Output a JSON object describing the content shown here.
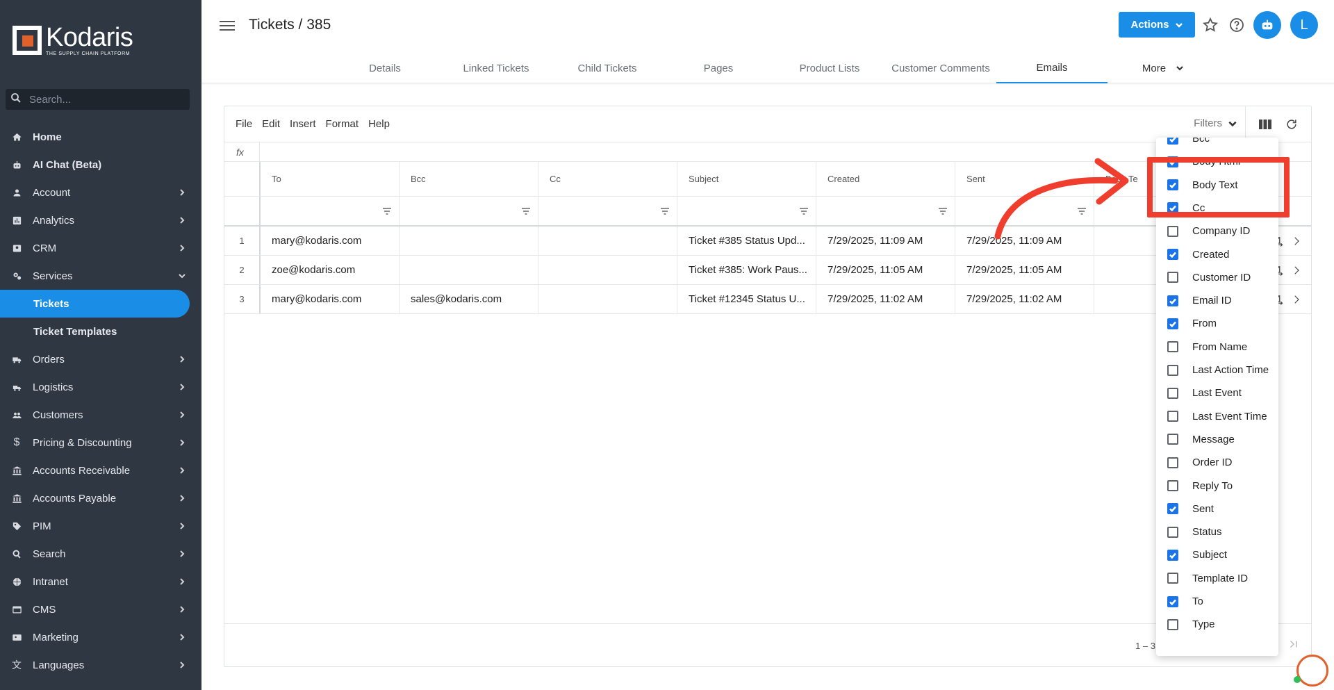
{
  "app": {
    "brand": "Kodaris",
    "tagline": "THE SUPPLY CHAIN PLATFORM"
  },
  "sidebar": {
    "search_placeholder": "Search...",
    "items": [
      {
        "label": "Home",
        "icon": "home-icon"
      },
      {
        "label": "AI Chat (Beta)",
        "icon": "robot-icon"
      },
      {
        "label": "Account",
        "icon": "person-icon"
      },
      {
        "label": "Analytics",
        "icon": "chart-icon"
      },
      {
        "label": "CRM",
        "icon": "contact-card-icon"
      },
      {
        "label": "Services",
        "icon": "gears-icon"
      },
      {
        "label": "Tickets",
        "icon": ""
      },
      {
        "label": "Ticket Templates",
        "icon": ""
      },
      {
        "label": "Orders",
        "icon": "truck-icon"
      },
      {
        "label": "Logistics",
        "icon": "shipping-icon"
      },
      {
        "label": "Customers",
        "icon": "people-icon"
      },
      {
        "label": "Pricing & Discounting",
        "icon": "dollar-icon"
      },
      {
        "label": "Accounts Receivable",
        "icon": "bank-icon"
      },
      {
        "label": "Accounts Payable",
        "icon": "bank-icon"
      },
      {
        "label": "PIM",
        "icon": "tag-icon"
      },
      {
        "label": "Search",
        "icon": "search-icon"
      },
      {
        "label": "Intranet",
        "icon": "globe-icon"
      },
      {
        "label": "CMS",
        "icon": "web-icon"
      },
      {
        "label": "Marketing",
        "icon": "marketing-icon"
      },
      {
        "label": "Languages",
        "icon": "translate-icon"
      }
    ]
  },
  "header": {
    "title": "Tickets / 385",
    "actions_label": "Actions",
    "avatar_initial": "L",
    "tabs": [
      "Details",
      "Linked Tickets",
      "Child Tickets",
      "Pages",
      "Product Lists",
      "Customer Comments",
      "Emails",
      "More"
    ],
    "active_tab": "Emails"
  },
  "grid": {
    "menu": [
      "File",
      "Edit",
      "Insert",
      "Format",
      "Help"
    ],
    "filters_label": "Filters",
    "fx_label": "fx",
    "columns": [
      "To",
      "Bcc",
      "Cc",
      "Subject",
      "Created",
      "Sent",
      "Body Te"
    ],
    "rows": [
      {
        "num": "1",
        "to": "mary@kodaris.com",
        "bcc": "",
        "cc": "",
        "subject": "Ticket #385 Status Upd...",
        "created": "7/29/2025, 11:09 AM",
        "sent": "7/29/2025, 11:09 AM"
      },
      {
        "num": "2",
        "to": "zoe@kodaris.com",
        "bcc": "",
        "cc": "",
        "subject": "Ticket #385: Work Paus...",
        "created": "7/29/2025, 11:05 AM",
        "sent": "7/29/2025, 11:05 AM"
      },
      {
        "num": "3",
        "to": "mary@kodaris.com",
        "bcc": "sales@kodaris.com",
        "cc": "",
        "subject": "Ticket #12345 Status U...",
        "created": "7/29/2025, 11:02 AM",
        "sent": "7/29/2025, 11:02 AM"
      }
    ],
    "pager_text": "1 – 3"
  },
  "column_chooser": [
    {
      "label": "Bcc",
      "checked": true
    },
    {
      "label": "Body Html",
      "checked": true
    },
    {
      "label": "Body Text",
      "checked": true
    },
    {
      "label": "Cc",
      "checked": true
    },
    {
      "label": "Company ID",
      "checked": false
    },
    {
      "label": "Created",
      "checked": true
    },
    {
      "label": "Customer ID",
      "checked": false
    },
    {
      "label": "Email ID",
      "checked": true
    },
    {
      "label": "From",
      "checked": true
    },
    {
      "label": "From Name",
      "checked": false
    },
    {
      "label": "Last Action Time",
      "checked": false
    },
    {
      "label": "Last Event",
      "checked": false
    },
    {
      "label": "Last Event Time",
      "checked": false
    },
    {
      "label": "Message",
      "checked": false
    },
    {
      "label": "Order ID",
      "checked": false
    },
    {
      "label": "Reply To",
      "checked": false
    },
    {
      "label": "Sent",
      "checked": true
    },
    {
      "label": "Status",
      "checked": false
    },
    {
      "label": "Subject",
      "checked": true
    },
    {
      "label": "Template ID",
      "checked": false
    },
    {
      "label": "To",
      "checked": true
    },
    {
      "label": "Type",
      "checked": false
    }
  ],
  "colors": {
    "sidebar_bg": "#2f3742",
    "accent": "#1a8ee6",
    "annotation": "#f03e2e",
    "brand_orange": "#e2612b"
  }
}
